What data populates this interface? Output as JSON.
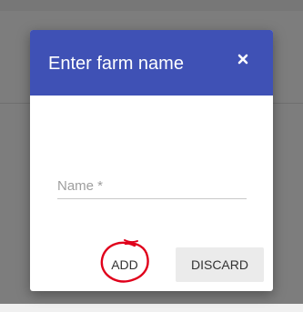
{
  "dialog": {
    "title": "Enter farm name",
    "close_icon": "close-icon",
    "name_field": {
      "label": "Name *",
      "value": ""
    },
    "actions": {
      "add_label": "ADD",
      "discard_label": "DISCARD"
    }
  },
  "colors": {
    "header": "#3f51b5",
    "backdrop": "#7d7d7d",
    "annotation": "#e0001b"
  }
}
